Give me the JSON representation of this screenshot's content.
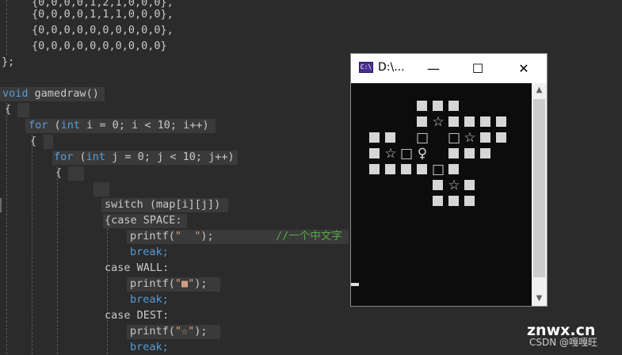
{
  "code": {
    "map_rows": [
      "{0,0,0,0,1,2,1,0,0,0},",
      "{0,0,0,0,1,1,1,0,0,0},",
      "{0,0,0,0,0,0,0,0,0,0},",
      "{0,0,0,0,0,0,0,0,0,0}"
    ],
    "close_brace": "};",
    "func_return_type": "void",
    "func_sig": " gamedraw()",
    "open_brace": "{",
    "for_kw": "for",
    "int_kw": "int",
    "for_i_rest": " i = 0; i < 10; i++)",
    "for_j_rest": " j = 0; j < 10; j++)",
    "for_open": " (",
    "switch_line": "switch (map[i][j])",
    "case_space": "{case SPACE:",
    "printf_open": "printf(",
    "printf_close": ");",
    "str_space": "\"  \"",
    "comment": "//一个中文字",
    "break_kw": "break;",
    "case_wall": "case WALL:",
    "str_wall": "\"■\"",
    "case_dest": "case DEST:",
    "str_dest": "\"☆\""
  },
  "console": {
    "title": "D:\\...",
    "icon_label": "C:\\",
    "minimize": "—",
    "maximize": "☐",
    "close": "✕",
    "scroll_up": "▲",
    "scroll_down": "▼",
    "grid": [
      "   ###    ",
      "   #☆####",
      "## □ □☆##",
      "#☆□♀ ###",
      "####□#  ",
      "    #☆#  ",
      "    ###  "
    ]
  },
  "watermark": {
    "site": "znwx.cn",
    "author": "CSDN @嘎嘎旺"
  }
}
